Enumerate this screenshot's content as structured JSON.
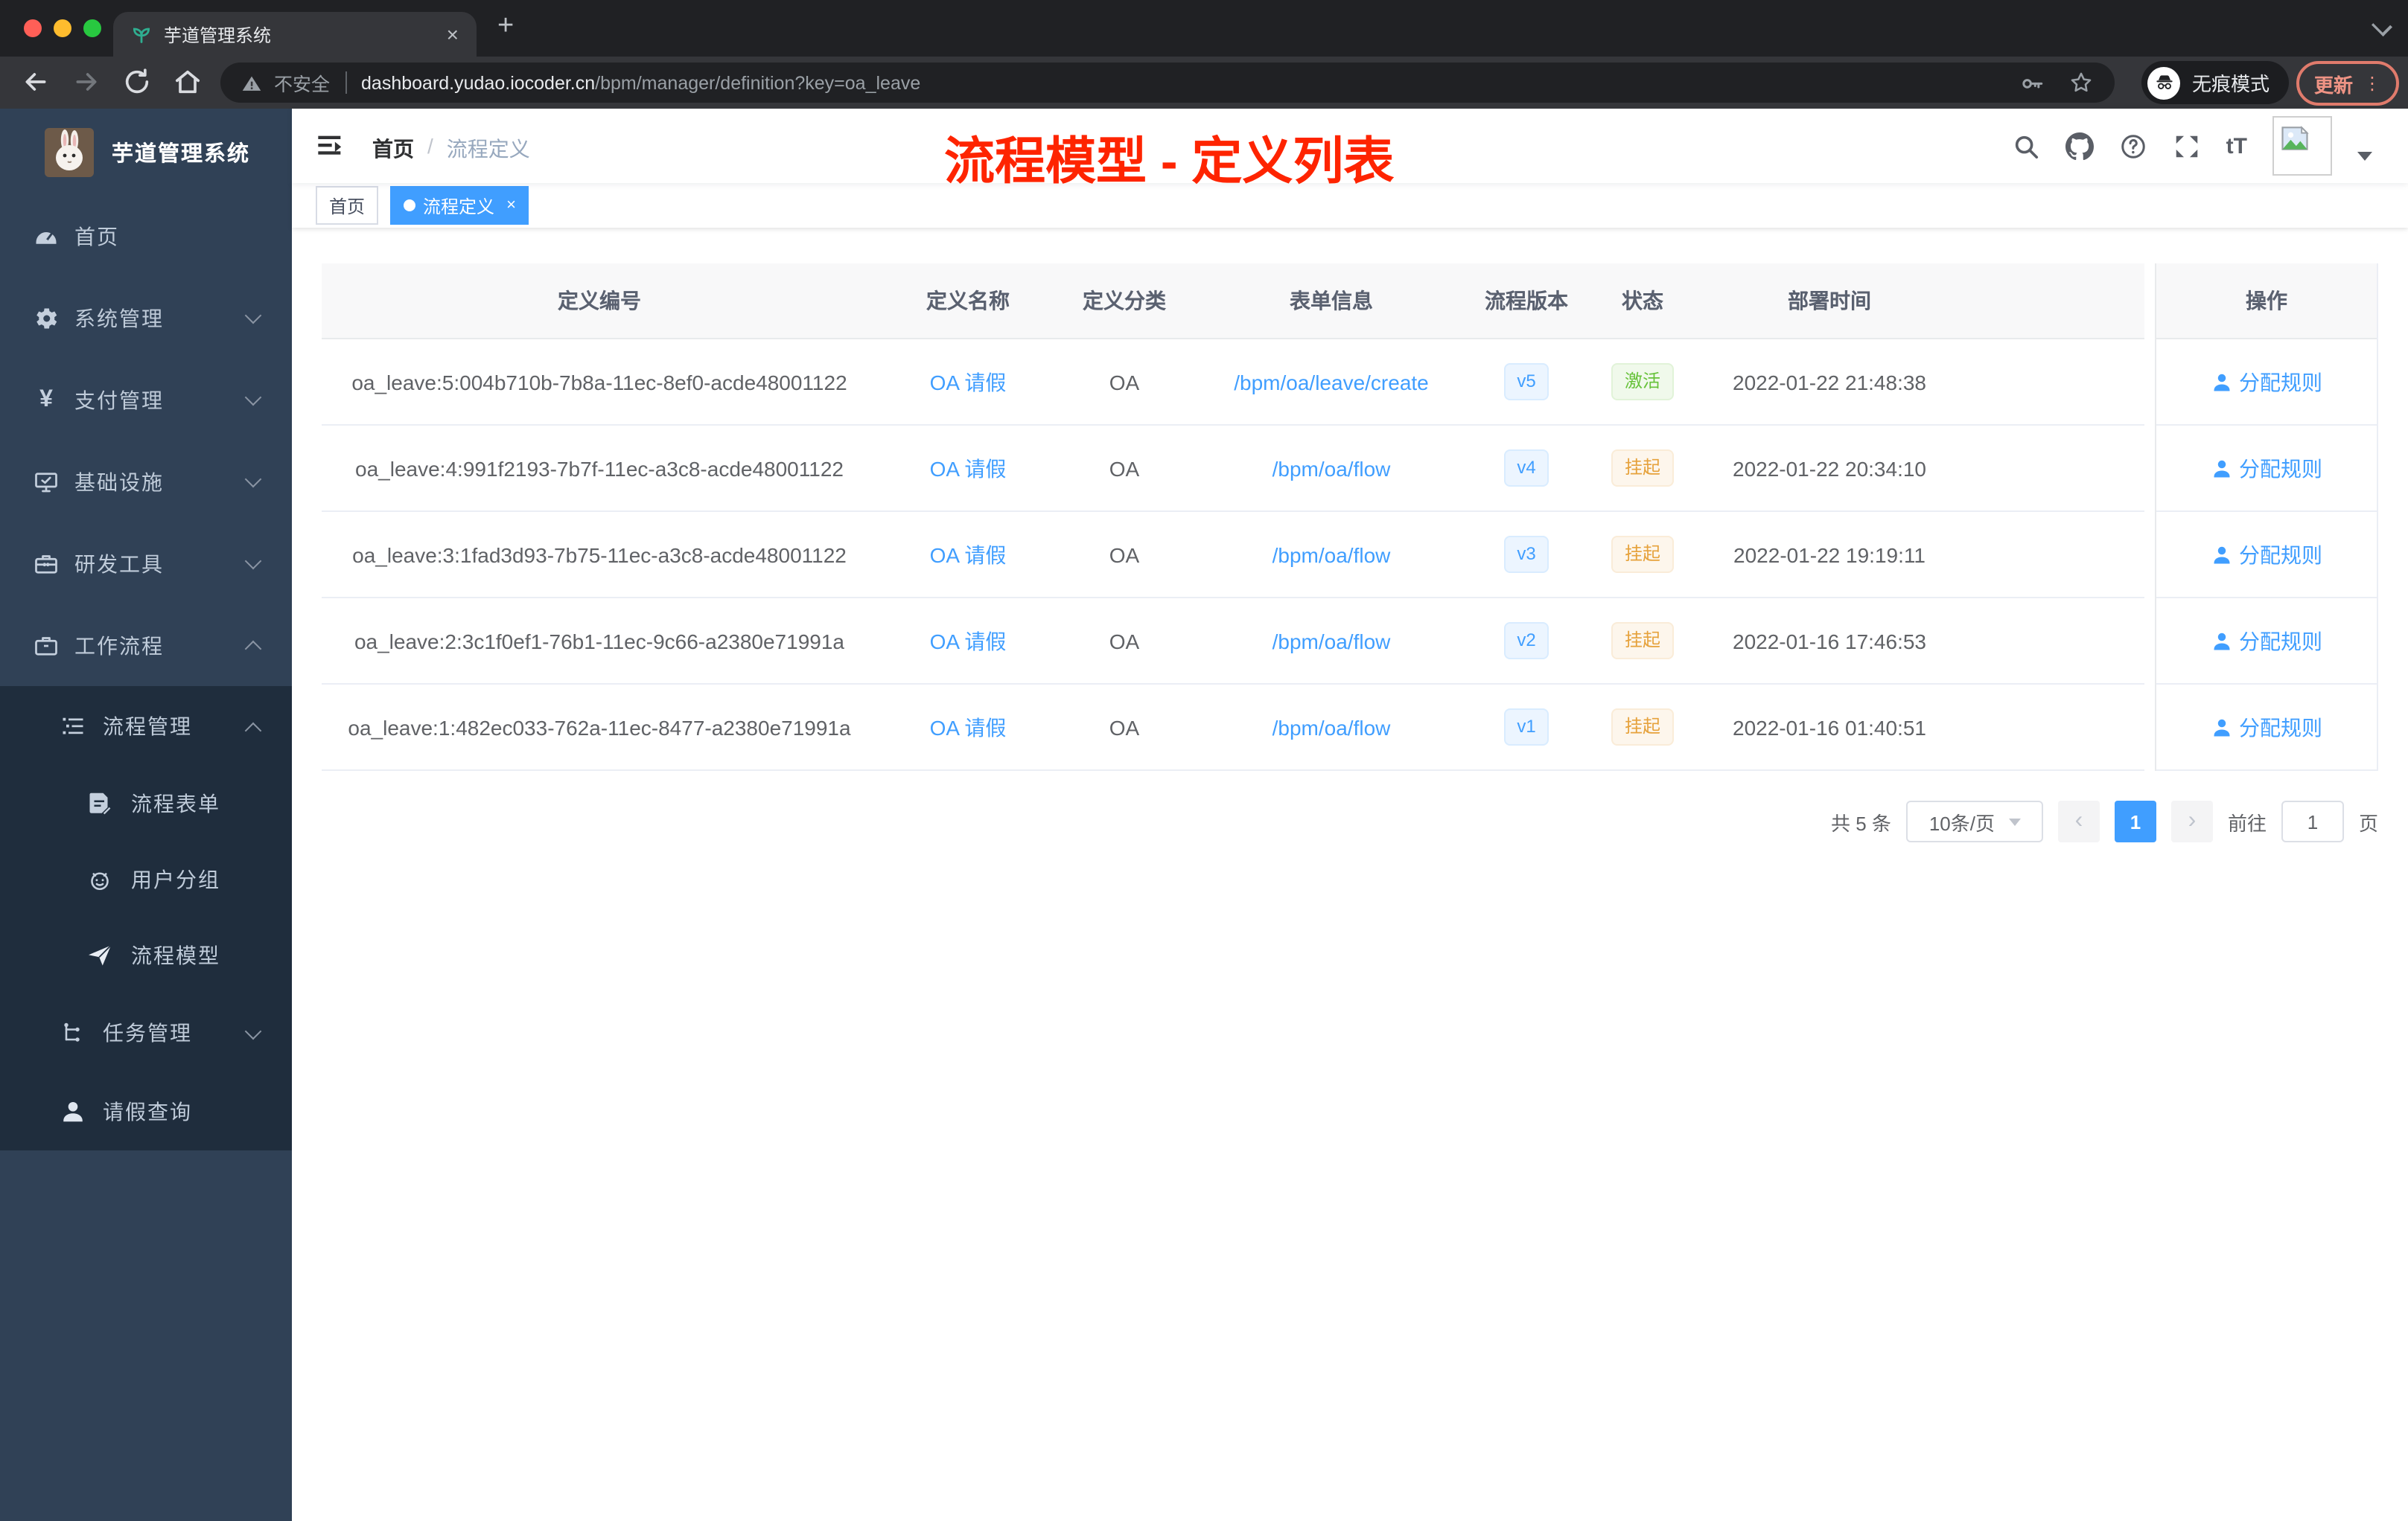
{
  "browser": {
    "tab_title": "芋道管理系统",
    "tab_close_icon": "×",
    "new_tab_icon": "+",
    "security_label": "不安全",
    "url_host": "dashboard.yudao.iocoder.cn",
    "url_path": "/bpm/manager/definition?key=oa_leave",
    "incognito_label": "无痕模式",
    "update_label": "更新",
    "more_icon": "⋮"
  },
  "sidebar": {
    "title": "芋道管理系统",
    "items": [
      {
        "label": "首页"
      },
      {
        "label": "系统管理"
      },
      {
        "label": "支付管理"
      },
      {
        "label": "基础设施"
      },
      {
        "label": "研发工具"
      },
      {
        "label": "工作流程"
      },
      {
        "label": "流程管理"
      },
      {
        "label": "流程表单"
      },
      {
        "label": "用户分组"
      },
      {
        "label": "流程模型"
      },
      {
        "label": "任务管理"
      },
      {
        "label": "请假查询"
      }
    ]
  },
  "header": {
    "breadcrumb": [
      "首页",
      "流程定义"
    ],
    "separator": "/",
    "annotation": "流程模型 - 定义列表"
  },
  "tags": {
    "home": "首页",
    "active": "流程定义",
    "close_icon": "×"
  },
  "table": {
    "columns": [
      "定义编号",
      "定义名称",
      "定义分类",
      "表单信息",
      "流程版本",
      "状态",
      "部署时间",
      "操作"
    ],
    "rows": [
      {
        "id": "oa_leave:5:004b710b-7b8a-11ec-8ef0-acde48001122",
        "name": "OA 请假",
        "category": "OA",
        "form": "/bpm/oa/leave/create",
        "version": "v5",
        "status": "激活",
        "status_type": "success",
        "deployed_at": "2022-01-22 21:48:38",
        "action": "分配规则"
      },
      {
        "id": "oa_leave:4:991f2193-7b7f-11ec-a3c8-acde48001122",
        "name": "OA 请假",
        "category": "OA",
        "form": "/bpm/oa/flow",
        "version": "v4",
        "status": "挂起",
        "status_type": "warning",
        "deployed_at": "2022-01-22 20:34:10",
        "action": "分配规则"
      },
      {
        "id": "oa_leave:3:1fad3d93-7b75-11ec-a3c8-acde48001122",
        "name": "OA 请假",
        "category": "OA",
        "form": "/bpm/oa/flow",
        "version": "v3",
        "status": "挂起",
        "status_type": "warning",
        "deployed_at": "2022-01-22 19:19:11",
        "action": "分配规则"
      },
      {
        "id": "oa_leave:2:3c1f0ef1-76b1-11ec-9c66-a2380e71991a",
        "name": "OA 请假",
        "category": "OA",
        "form": "/bpm/oa/flow",
        "version": "v2",
        "status": "挂起",
        "status_type": "warning",
        "deployed_at": "2022-01-16 17:46:53",
        "action": "分配规则"
      },
      {
        "id": "oa_leave:1:482ec033-762a-11ec-8477-a2380e71991a",
        "name": "OA 请假",
        "category": "OA",
        "form": "/bpm/oa/flow",
        "version": "v1",
        "status": "挂起",
        "status_type": "warning",
        "deployed_at": "2022-01-16 01:40:51",
        "action": "分配规则"
      }
    ]
  },
  "pagination": {
    "total": "共 5 条",
    "page_size": "10条/页",
    "prev_icon": "‹",
    "next_icon": "›",
    "page": "1",
    "goto": "前往",
    "goto_page": "1",
    "page_unit": "页"
  },
  "colors": {
    "accent": "#409eff",
    "success": "#67c23a",
    "warning": "#e6a23c",
    "annotation_red": "#fe2400",
    "sidebar_bg": "#304156",
    "submenu_bg": "#1f2d3d"
  }
}
